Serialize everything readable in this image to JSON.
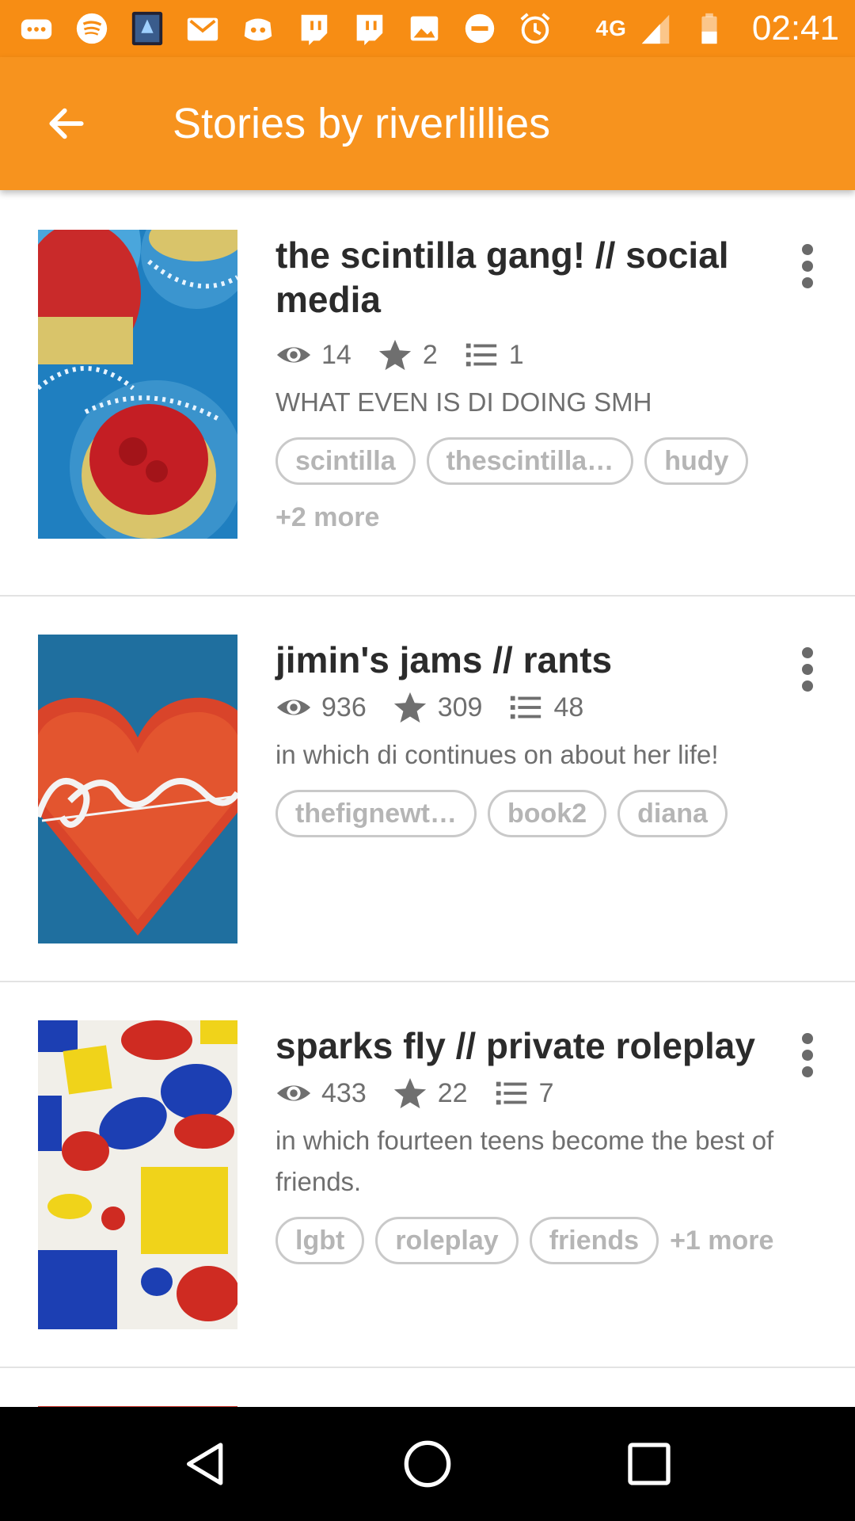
{
  "status_bar": {
    "icons": [
      "more-notifications-icon",
      "spotify-icon",
      "app-icon",
      "gmail-icon",
      "discord-icon",
      "twitch-icon",
      "twitch-icon",
      "image-icon",
      "do-not-disturb-icon",
      "alarm-icon"
    ],
    "network": "4G",
    "time": "02:41"
  },
  "app_bar": {
    "title": "Stories by riverlillies",
    "back_icon": "arrow-back-icon"
  },
  "stories": [
    {
      "title": "the scintilla gang! // social media",
      "reads": "14",
      "votes": "2",
      "parts": "1",
      "description": "WHAT EVEN IS DI DOING SMH",
      "tags": [
        "scintilla",
        "thescintilla…",
        "hudy"
      ],
      "more": "+2 more"
    },
    {
      "title": "jimin's jams // rants",
      "reads": "936",
      "votes": "309",
      "parts": "48",
      "description": "in which di continues on about her life!",
      "tags": [
        "thefignewt…",
        "book2",
        "diana"
      ],
      "more": ""
    },
    {
      "title": "sparks fly // private roleplay",
      "reads": "433",
      "votes": "22",
      "parts": "7",
      "description": "in which fourteen teens become the best of friends.",
      "tags": [
        "lgbt",
        "roleplay",
        "friends"
      ],
      "more": "+1 more"
    }
  ],
  "colors": {
    "status_bar": "#f78d14",
    "app_bar": "#f7931e",
    "title_text": "#2b2b2b",
    "meta_text": "#6f6f6f",
    "tag_text": "#b5b5b5"
  },
  "nav_bar": {
    "icons": [
      "back-triangle-icon",
      "home-circle-icon",
      "recents-square-icon"
    ]
  }
}
